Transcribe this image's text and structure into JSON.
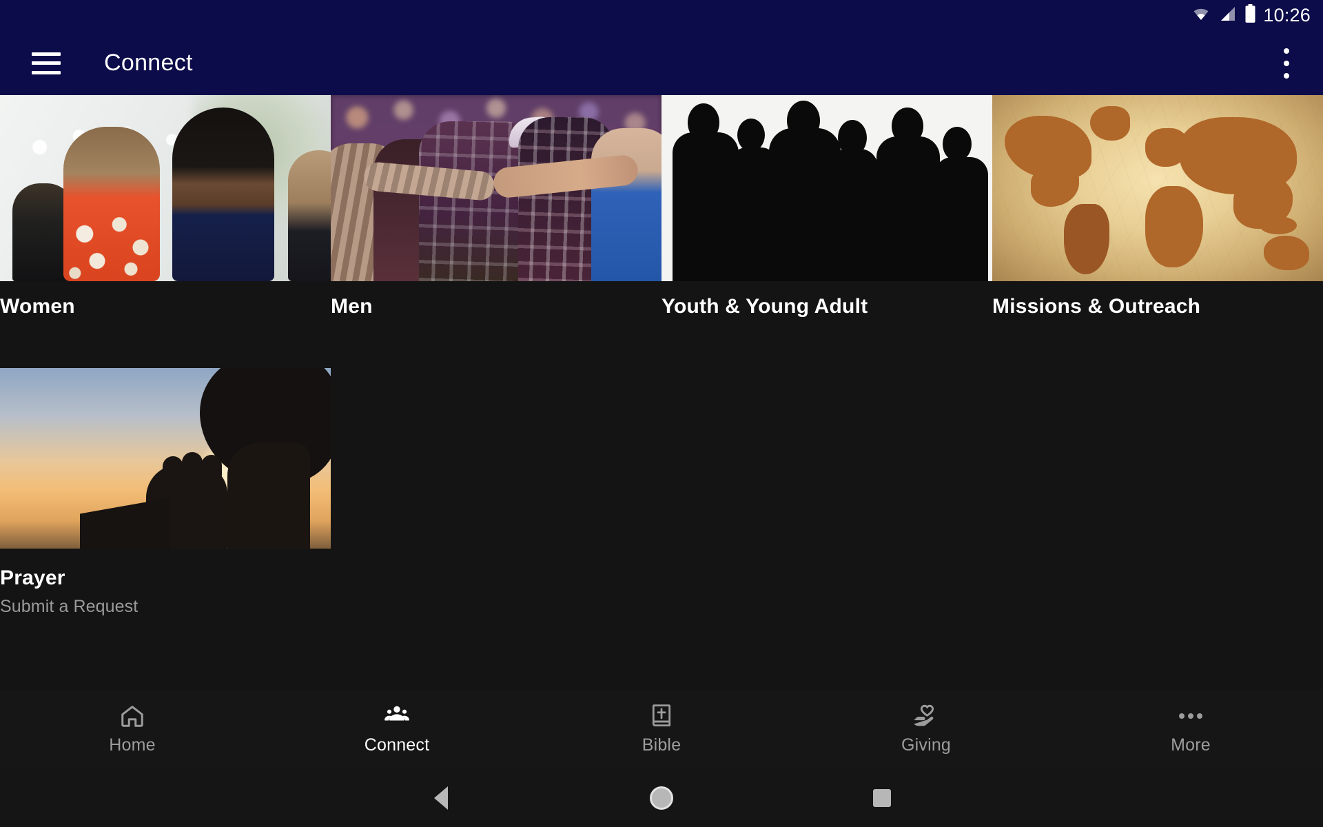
{
  "status_bar": {
    "time": "10:26",
    "icons": [
      "wifi-icon",
      "cell-signal-icon",
      "battery-icon"
    ]
  },
  "app_bar": {
    "menu_icon": "hamburger-menu-icon",
    "title": "Connect",
    "overflow_icon": "overflow-menu-icon",
    "background_color": "#0c0c4a"
  },
  "theme": {
    "background": "#141414",
    "primary": "#0c0c4a",
    "text_primary": "#ffffff",
    "text_secondary": "#9a9a9a",
    "nav_inactive": "#9c9c9c"
  },
  "cards": [
    {
      "title": "Women",
      "subtitle": "",
      "image": "two-women-outdoors-photo"
    },
    {
      "title": "Men",
      "subtitle": "",
      "image": "men-praying-huddle-photo"
    },
    {
      "title": "Youth & Young Adult",
      "subtitle": "",
      "image": "group-silhouettes-illustration"
    },
    {
      "title": "Missions & Outreach",
      "subtitle": "",
      "image": "vintage-world-map-photo"
    },
    {
      "title": "Prayer",
      "subtitle": "Submit a Request",
      "image": "praying-hands-sunset-photo"
    }
  ],
  "bottom_nav": {
    "items": [
      {
        "label": "Home",
        "icon": "home-icon",
        "active": false
      },
      {
        "label": "Connect",
        "icon": "people-group-icon",
        "active": true
      },
      {
        "label": "Bible",
        "icon": "bible-book-icon",
        "active": false
      },
      {
        "label": "Giving",
        "icon": "hand-heart-icon",
        "active": false
      },
      {
        "label": "More",
        "icon": "more-dots-icon",
        "active": false
      }
    ]
  },
  "system_nav": {
    "back": "back-triangle-icon",
    "home": "home-circle-icon",
    "recents": "recents-square-icon"
  }
}
